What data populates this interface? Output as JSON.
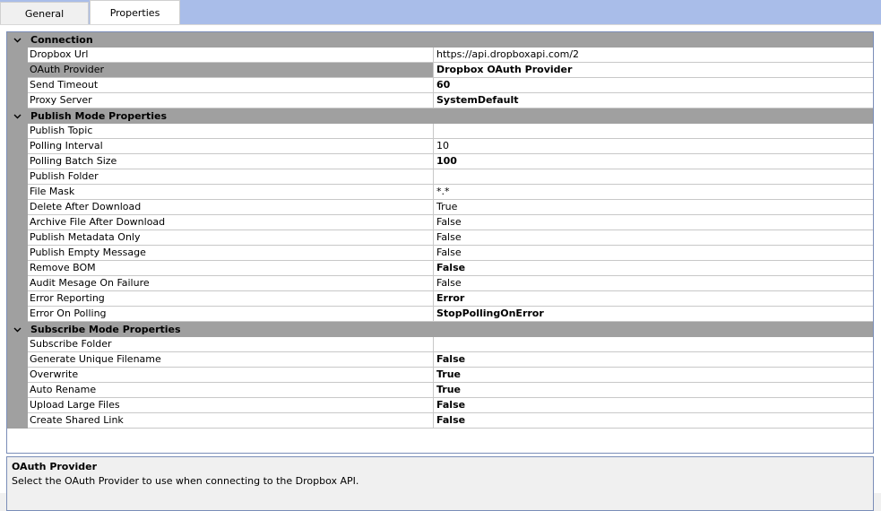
{
  "tabs": [
    {
      "label": "General",
      "active": false
    },
    {
      "label": "Properties",
      "active": true
    }
  ],
  "colors": {
    "tab_strip": "#a9bde9",
    "category_background": "#a0a0a0",
    "grid_border": "#7a8db8"
  },
  "categories": [
    {
      "name": "Connection",
      "expanded": true,
      "icon": "chevron-down-icon",
      "properties": [
        {
          "name": "Dropbox Url",
          "value": "https://api.dropboxapi.com/2",
          "bold": false,
          "selected": false
        },
        {
          "name": "OAuth Provider",
          "value": "Dropbox OAuth Provider",
          "bold": true,
          "selected": true
        },
        {
          "name": "Send Timeout",
          "value": "60",
          "bold": true,
          "selected": false
        },
        {
          "name": "Proxy Server",
          "value": "SystemDefault",
          "bold": true,
          "selected": false
        }
      ]
    },
    {
      "name": "Publish Mode Properties",
      "expanded": true,
      "icon": "chevron-down-icon",
      "properties": [
        {
          "name": "Publish Topic",
          "value": "",
          "bold": false,
          "selected": false
        },
        {
          "name": "Polling Interval",
          "value": "10",
          "bold": false,
          "selected": false
        },
        {
          "name": "Polling Batch Size",
          "value": "100",
          "bold": true,
          "selected": false
        },
        {
          "name": "Publish Folder",
          "value": "",
          "bold": false,
          "selected": false
        },
        {
          "name": "File Mask",
          "value": "*.*",
          "bold": false,
          "selected": false
        },
        {
          "name": "Delete After Download",
          "value": "True",
          "bold": false,
          "selected": false
        },
        {
          "name": "Archive File After Download",
          "value": "False",
          "bold": false,
          "selected": false
        },
        {
          "name": "Publish Metadata Only",
          "value": "False",
          "bold": false,
          "selected": false
        },
        {
          "name": "Publish Empty Message",
          "value": "False",
          "bold": false,
          "selected": false
        },
        {
          "name": "Remove BOM",
          "value": "False",
          "bold": true,
          "selected": false
        },
        {
          "name": "Audit Mesage On Failure",
          "value": "False",
          "bold": false,
          "selected": false
        },
        {
          "name": "Error Reporting",
          "value": "Error",
          "bold": true,
          "selected": false
        },
        {
          "name": "Error On Polling",
          "value": "StopPollingOnError",
          "bold": true,
          "selected": false
        }
      ]
    },
    {
      "name": "Subscribe Mode Properties",
      "expanded": true,
      "icon": "chevron-down-icon",
      "properties": [
        {
          "name": "Subscribe Folder",
          "value": "",
          "bold": false,
          "selected": false
        },
        {
          "name": "Generate Unique Filename",
          "value": "False",
          "bold": true,
          "selected": false
        },
        {
          "name": "Overwrite",
          "value": "True",
          "bold": true,
          "selected": false
        },
        {
          "name": "Auto Rename",
          "value": "True",
          "bold": true,
          "selected": false
        },
        {
          "name": "Upload Large Files",
          "value": "False",
          "bold": true,
          "selected": false
        },
        {
          "name": "Create Shared Link",
          "value": "False",
          "bold": true,
          "selected": false
        }
      ]
    }
  ],
  "description": {
    "title": "OAuth Provider",
    "text": "Select the OAuth Provider to use when connecting to the Dropbox API."
  }
}
